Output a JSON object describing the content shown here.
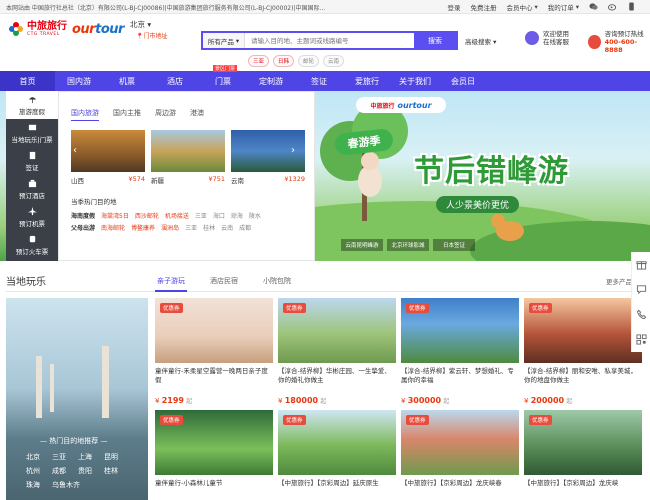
{
  "topbar": {
    "notice": "本网站由 中国旅行社总社（北京）有限公司(L-BJ-CJ00086)|中国旅游集团旅行服务有限公司(L-BJ-CJ00002)|中国国际...",
    "links": [
      "登录",
      "免费注册",
      "会员中心",
      "我的订单"
    ]
  },
  "header": {
    "logo_cn": "中旅旅行",
    "logo_en": "CTG TRAVEL",
    "logo2_a": "our",
    "logo2_b": "tour",
    "city": "北京",
    "city_sub": "门市地址",
    "search_select": "所有产品",
    "search_placeholder": "请输入目的地、主题词或线路编号",
    "search_button": "搜索",
    "advanced": "高级搜索",
    "tags": [
      "三亚",
      "日韩",
      "邮轮",
      "云南"
    ],
    "service_line1": "欢迎使用",
    "service_line2": "在线客服",
    "hotline_line1": "咨询预订热线",
    "hotline_line2": "400-600-8888"
  },
  "nav": {
    "items": [
      "首页",
      "国内游",
      "机票",
      "酒店",
      "门票",
      "定制游",
      "签证",
      "爱旅行",
      "关于我们",
      "会员日"
    ],
    "badge": "景区门票"
  },
  "catmenu": {
    "items": [
      "旅游度假",
      "当地玩乐|门票",
      "签证",
      "预订酒店",
      "预订机票",
      "预订火车票"
    ]
  },
  "panel": {
    "tabs": [
      "国内旅游",
      "国内主推",
      "周边游",
      "港澳"
    ],
    "cards": [
      {
        "name": "山西",
        "price": "574"
      },
      {
        "name": "新疆",
        "price": "751"
      },
      {
        "name": "云南",
        "price": "1329"
      }
    ],
    "hot_title": "当季热门目的地",
    "row1_label": "海南度假",
    "row1_red": [
      "海棠湾5日",
      "西沙邮轮",
      "机场接送"
    ],
    "row1_gray": [
      "三亚",
      "海口",
      "琼海",
      "陵水"
    ],
    "row2_label": "父母出游",
    "row2_red": [
      "南海邮轮",
      "博鳌康养",
      "涠洲岛"
    ],
    "row2_gray": [
      "三亚",
      "桂林",
      "云南",
      "成都"
    ]
  },
  "banner": {
    "logo_cn": "中旅旅行",
    "logo_en": "ourtour",
    "badge": "春游季",
    "title": "节后错峰游",
    "subtitle": "人少景美价更优",
    "thumbs": [
      "云南昆明峰游",
      "北京环球影城",
      "日本签证"
    ]
  },
  "section": {
    "title": "当地玩乐",
    "tabs": [
      "亲子游玩",
      "酒店民宿",
      "小院包院"
    ],
    "more": "更多产品",
    "side_hot": "— 热门目的地推荐 —",
    "side_cities": [
      "北京",
      "三亚",
      "上海",
      "昆明",
      "杭州",
      "成都",
      "贵阳",
      "桂林",
      "珠海",
      "乌鲁木齐"
    ],
    "coupon": "优惠券",
    "products": [
      {
        "name": "童伴童行-禾柔星空露营一晚两日亲子度假",
        "price": "2199",
        "unit": "起"
      },
      {
        "name": "【淳合-结界柳】华彬庄园、一生挚爱、你的婚礼你做主",
        "price": "180000",
        "unit": "起"
      },
      {
        "name": "【淳合-结界柳】紫云轩、梦想婚礼、专属你的幸福",
        "price": "300000",
        "unit": "起"
      },
      {
        "name": "【淳合-结界柳】丽和安唯、私享美城，你的地盘你做主",
        "price": "200000",
        "unit": "起"
      },
      {
        "name": "童伴童行-小森林儿童节",
        "price": "",
        "unit": ""
      },
      {
        "name": "【中旅旅行】【京彩周边】延庆原生",
        "price": "",
        "unit": ""
      },
      {
        "name": "【中旅旅行】【京彩周边】龙庆峡春",
        "price": "",
        "unit": ""
      },
      {
        "name": "【中旅旅行】【京彩周边】龙庆峡",
        "price": "",
        "unit": ""
      }
    ]
  },
  "currency": "¥"
}
